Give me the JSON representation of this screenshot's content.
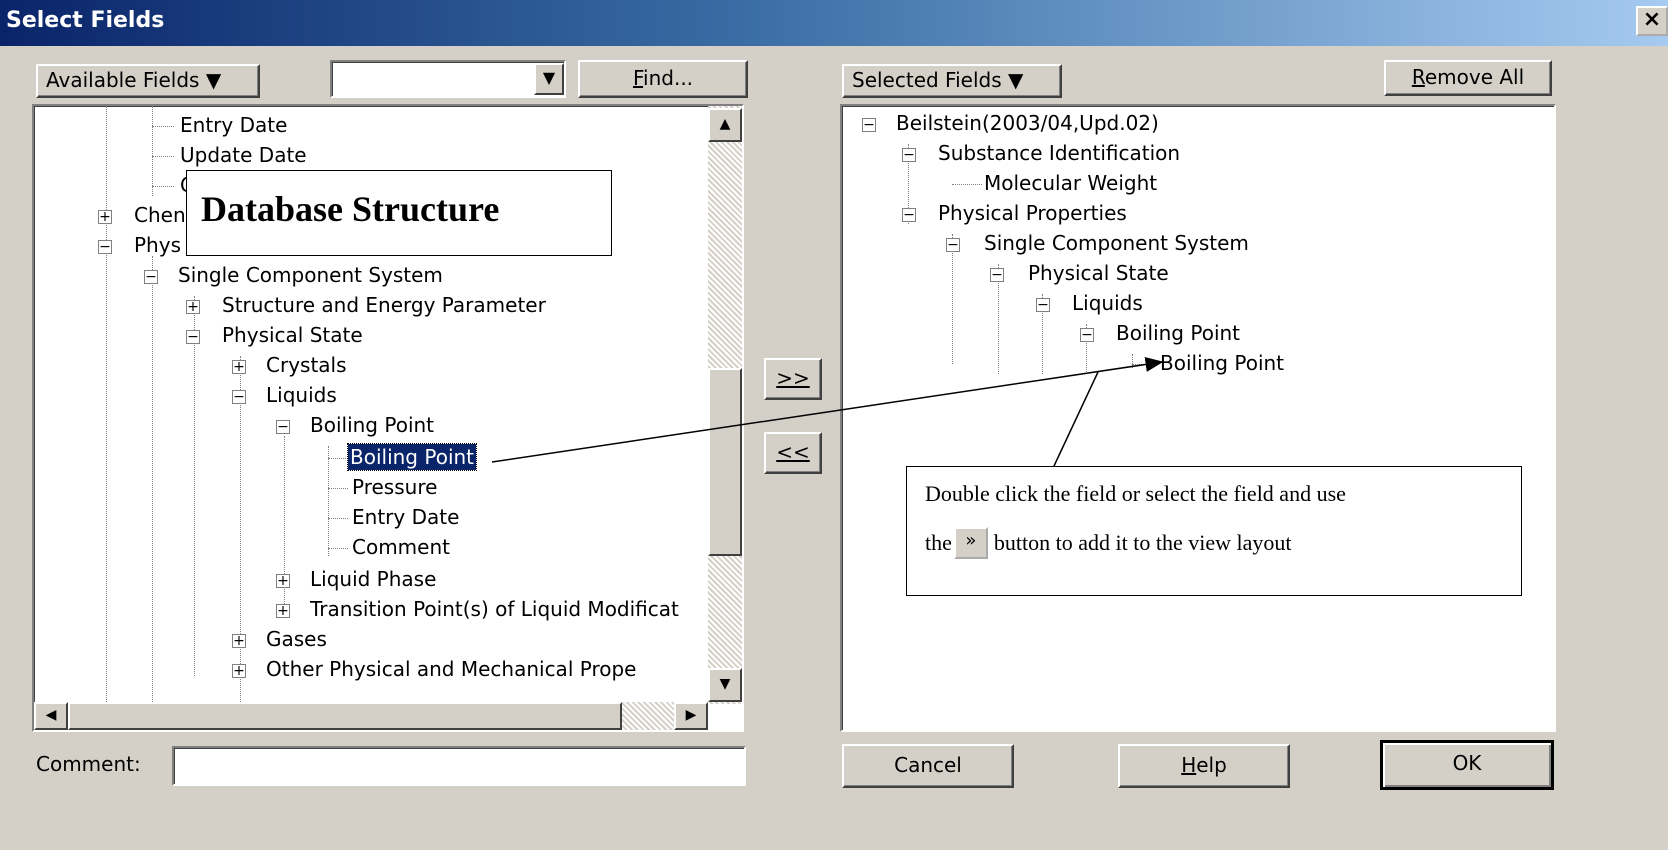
{
  "window": {
    "title": "Select Fields",
    "close": "×"
  },
  "left": {
    "available_label": "Available Fields",
    "dropdown_value": "",
    "find_label": "Find...",
    "find_underline": "F",
    "find_rest": "ind...",
    "tree": [
      {
        "label": "Entry Date"
      },
      {
        "label": "Update Date"
      },
      {
        "label": "C"
      },
      {
        "label": "Chen"
      },
      {
        "label": "Phys"
      },
      {
        "label": "Single Component System"
      },
      {
        "label": "Structure and Energy Parameter"
      },
      {
        "label": "Physical State"
      },
      {
        "label": "Crystals"
      },
      {
        "label": "Liquids"
      },
      {
        "label": "Boiling Point"
      },
      {
        "label": "Boiling Point"
      },
      {
        "label": "Pressure"
      },
      {
        "label": "Entry Date"
      },
      {
        "label": "Comment"
      },
      {
        "label": "Liquid Phase"
      },
      {
        "label": "Transition Point(s) of Liquid Modificat"
      },
      {
        "label": "Gases"
      },
      {
        "label": "Other Physical and Mechanical Prope"
      }
    ]
  },
  "middle": {
    "add_label": ">>",
    "remove_label": "<<"
  },
  "right": {
    "selected_label": "Selected Fields",
    "remove_all_underline": "R",
    "remove_all_rest": "emove All",
    "tree": [
      {
        "label": "Beilstein(2003/04,Upd.02)"
      },
      {
        "label": "Substance Identification"
      },
      {
        "label": "Molecular Weight"
      },
      {
        "label": "Physical Properties"
      },
      {
        "label": "Single Component System"
      },
      {
        "label": "Physical State"
      },
      {
        "label": "Liquids"
      },
      {
        "label": "Boiling Point"
      },
      {
        "label": "Boiling Point"
      }
    ]
  },
  "bottom": {
    "comment_label": "Comment:",
    "comment_value": "",
    "cancel_label": "Cancel",
    "help_underline": "H",
    "help_rest": "elp",
    "ok_label": "OK"
  },
  "annotations": {
    "db_structure": "Database Structure",
    "instruction_line1": "Double click the field or select the field and use",
    "instruction_pre": "the",
    "instruction_btn": "»",
    "instruction_post": "button to add it to the view layout"
  }
}
